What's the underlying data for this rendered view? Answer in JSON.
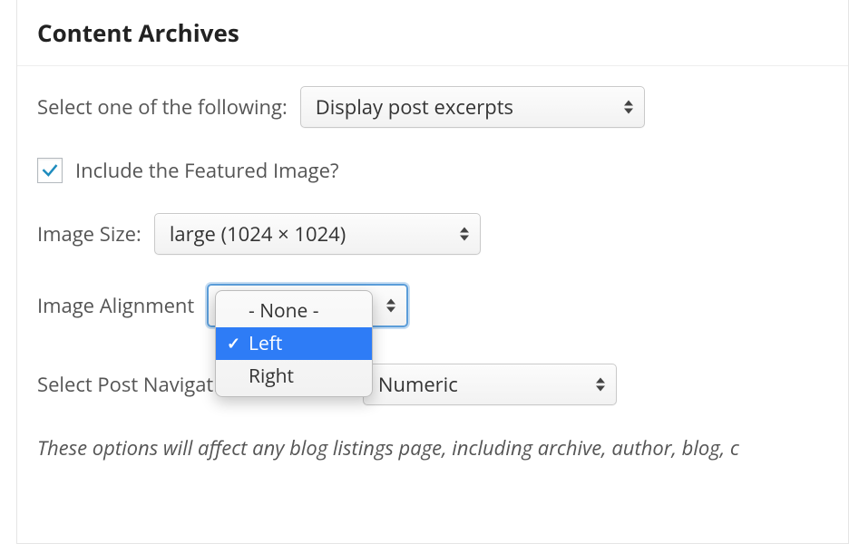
{
  "panel": {
    "title": "Content Archives"
  },
  "contentDisplay": {
    "label": "Select one of the following:",
    "value": "Display post excerpts"
  },
  "featuredImage": {
    "checked": true,
    "label": "Include the Featured Image?"
  },
  "imageSize": {
    "label": "Image Size:",
    "value": "large (1024 × 1024)"
  },
  "imageAlignment": {
    "label": "Image Alignment",
    "options": [
      "- None -",
      "Left",
      "Right"
    ],
    "selectedIndex": 1
  },
  "postNav": {
    "label": "Select Post Navigation Technique:",
    "value": "Numeric"
  },
  "note": "These options will affect any blog listings page, including archive, author, blog, c"
}
